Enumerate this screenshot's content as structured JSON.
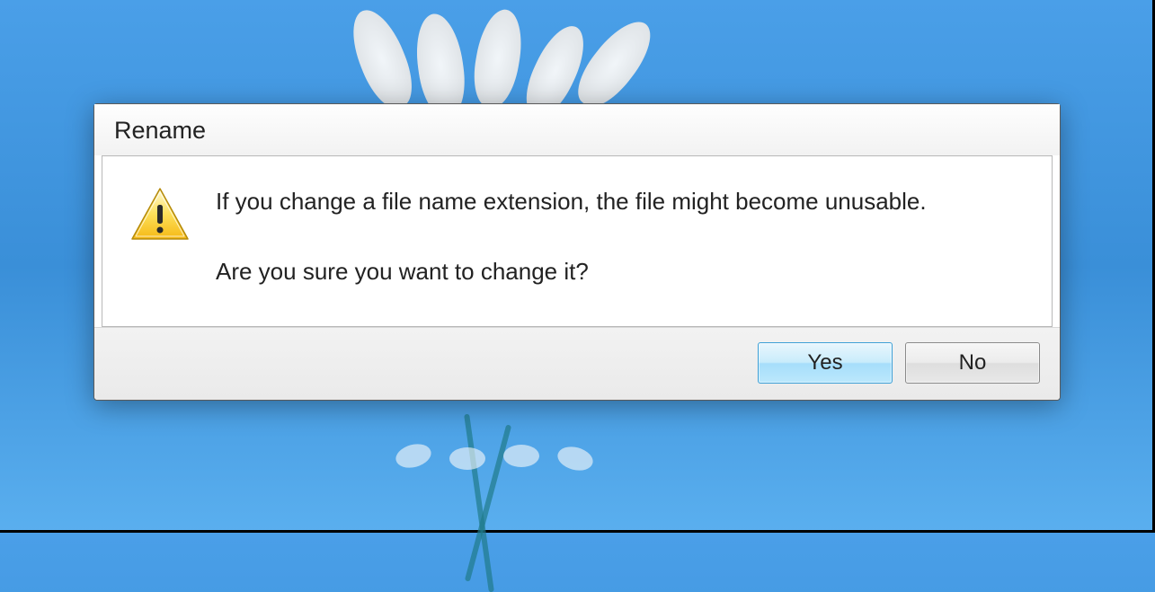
{
  "dialog": {
    "title": "Rename",
    "message_line1": "If you change a file name extension, the file might become unusable.",
    "message_line2": "Are you sure you want to change it?",
    "buttons": {
      "yes": "Yes",
      "no": "No"
    },
    "icon": "warning-icon"
  }
}
